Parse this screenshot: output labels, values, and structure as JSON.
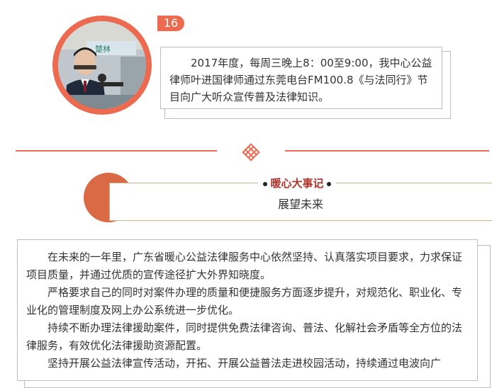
{
  "badge": {
    "number": "16"
  },
  "photo": {
    "sign_text": "楚林"
  },
  "caption": {
    "text": "2017年度，每周三晚上8：00至9:00，我中心公益律师叶进国律师通过东莞电台FM100.8《与法同行》节目向广大听众宣传普及法律知识。"
  },
  "section": {
    "title": "暖心大事记",
    "subtitle": "展望未来"
  },
  "body": {
    "paragraphs": [
      "在未来的一年里，广东省暖心公益法律服务中心依然坚持、认真落实项目要求，力求保证项目质量，并通过优质的宣传途径扩大外界知晓度。",
      "严格要求自己的同时对案件办理的质量和便捷服务方面逐步提升，对规范化、职业化、专业化的管理制度及网上办公系统进一步优化。",
      "持续不断办理法律援助案件，同时提供免费法律咨询、普法、化解社会矛盾等全方位的法律服务，有效优化法律援助资源配置。",
      "坚持开展公益法律宣传活动，开拓、开展公益普法走进校园活动，持续通过电波向广"
    ]
  },
  "colors": {
    "accent": "#ec6a4f",
    "title_red": "#b0352c",
    "header_border": "#ccb38a"
  },
  "icons": {
    "divider": "chinese-knot-icon"
  }
}
